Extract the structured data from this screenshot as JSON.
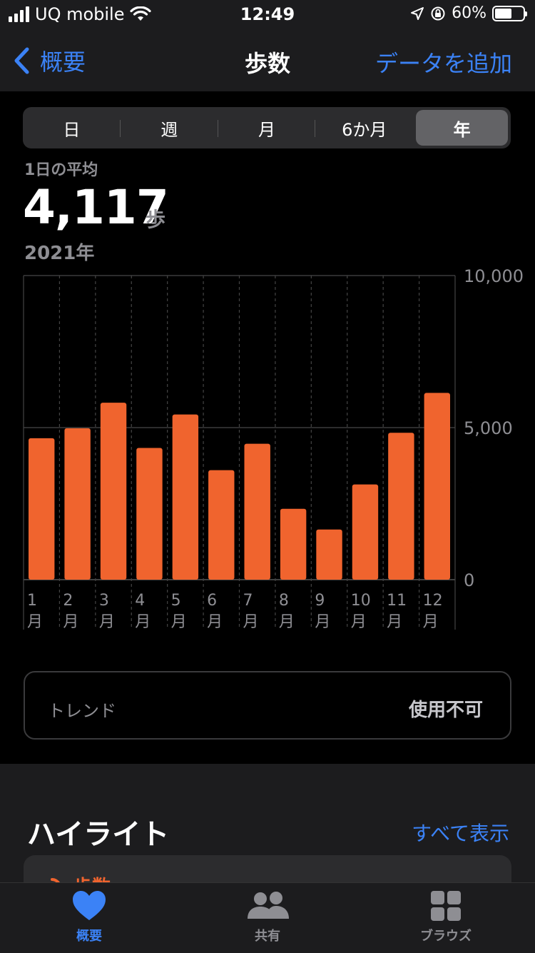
{
  "status_bar": {
    "carrier": "UQ mobile",
    "time": "12:49",
    "battery": "60%",
    "battery_level": 0.6
  },
  "nav": {
    "back_label": "概要",
    "title": "歩数",
    "add_label": "データを追加"
  },
  "segments": {
    "items": [
      "日",
      "週",
      "月",
      "6か月",
      "年"
    ],
    "selected": "年"
  },
  "summary": {
    "label": "1日の平均",
    "value": "4,117",
    "unit": "歩",
    "period": "2021年"
  },
  "chart_data": {
    "type": "bar",
    "categories": [
      "1月",
      "2月",
      "3月",
      "4月",
      "5月",
      "6月",
      "7月",
      "8月",
      "9月",
      "10月",
      "11月",
      "12月"
    ],
    "values": [
      4650,
      4980,
      5820,
      4330,
      5430,
      3600,
      4470,
      2330,
      1650,
      3130,
      4830,
      6140
    ],
    "y_ticks": [
      "0",
      "5,000",
      "10,000"
    ],
    "ylim": [
      0,
      10000
    ],
    "grid": true,
    "bar_color": "#f0642e"
  },
  "trend": {
    "label": "トレンド",
    "value": "使用不可"
  },
  "highlights": {
    "title": "ハイライト",
    "show_all": "すべて表示",
    "card_title": "歩数"
  },
  "tab_bar": {
    "items": [
      {
        "label": "概要",
        "icon": "heart-icon",
        "active": true
      },
      {
        "label": "共有",
        "icon": "people-icon",
        "active": false
      },
      {
        "label": "ブラウズ",
        "icon": "grid-icon",
        "active": false
      }
    ]
  },
  "colors": {
    "accent": "#3b82f6",
    "steps": "#f0642e",
    "inactive": "#8e8e93"
  }
}
